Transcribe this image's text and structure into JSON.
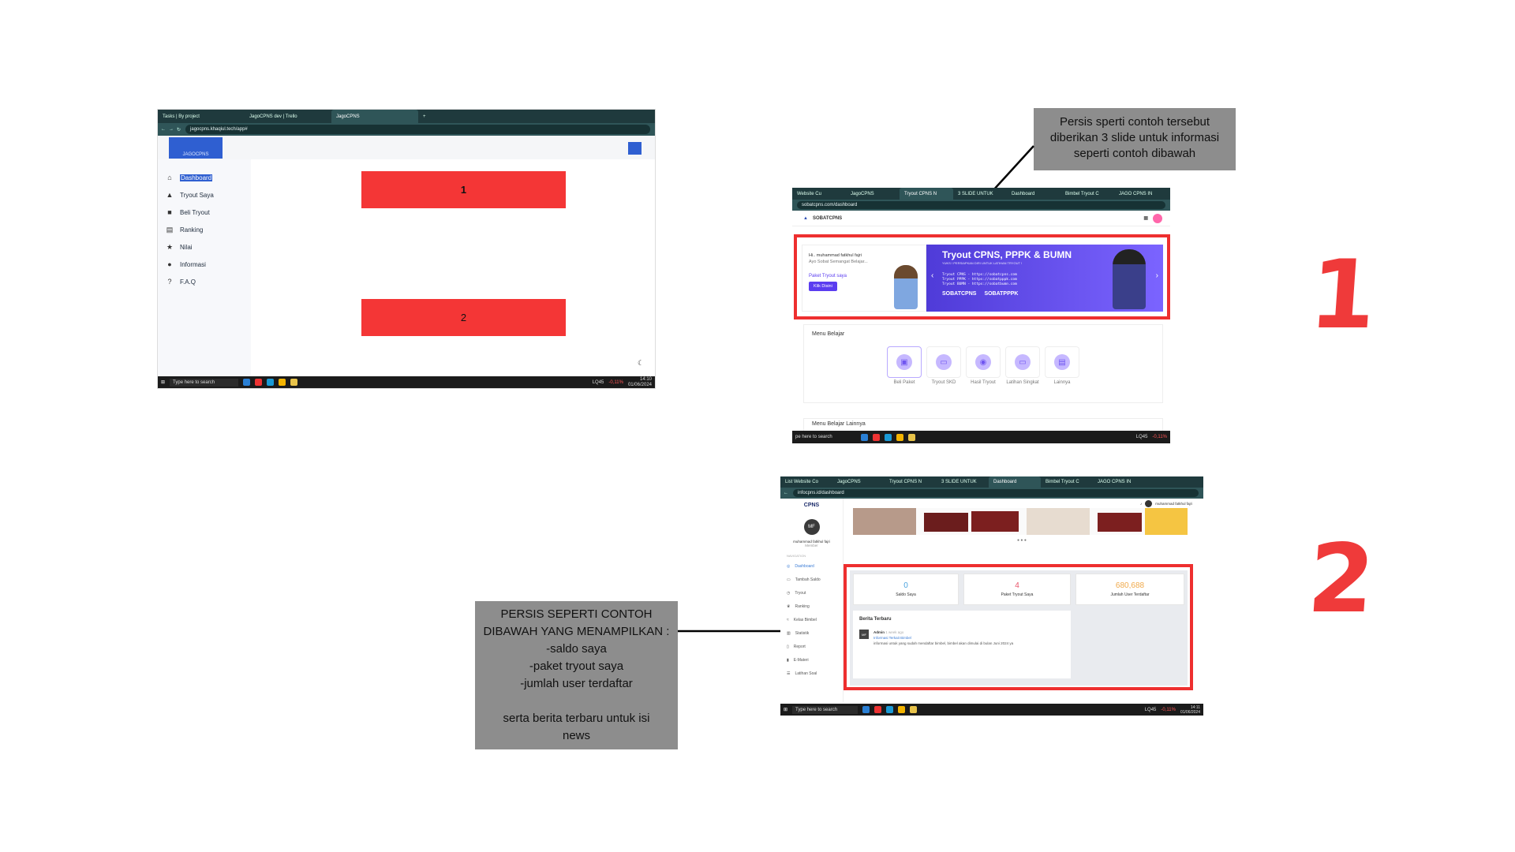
{
  "colors": {
    "annotation_gray": "#8d8d8d",
    "red": "#ef3a3a",
    "banner_purple": "#6f55f0",
    "chrome_teal": "#1f3a3d"
  },
  "left_shot": {
    "tabs": [
      "Tasks | By project",
      "JagoCPNS dev | Trello",
      "JagoCPNS"
    ],
    "url": "jagocpns.khaqiul.tech/app#",
    "logo_text": "JAGOCPNS",
    "sidebar": [
      "Dashboard",
      "Tryout Saya",
      "Beli Tryout",
      "Ranking",
      "Nilai",
      "Informasi",
      "F.A.Q"
    ],
    "placeholder_1": "1",
    "placeholder_2": "2",
    "taskbar": {
      "search": "Type here to search",
      "ticker": "LQ45",
      "change": "-0,11%",
      "time": "14:10",
      "date": "01/06/2024"
    }
  },
  "annotation_1": {
    "lines": [
      "Persis sperti contoh tersebut",
      "diberikan 3 slide untuk informasi",
      "seperti contoh dibawah"
    ]
  },
  "annotation_2": {
    "lines": [
      "PERSIS SEPERTI CONTOH",
      "DIBAWAH YANG MENAMPILKAN :",
      "-saldo saya",
      "-paket tryout saya",
      "-jumlah user terdaftar",
      "",
      "serta berita terbaru untuk isi",
      "news"
    ]
  },
  "label_1": "1",
  "label_2": "2",
  "sobat_shot": {
    "tabs": [
      "Website Cu",
      "JagoCPNS",
      "Tryout CPNS N",
      "3 SLIDE UNTUK",
      "Dashboard",
      "Bimbel Tryout C",
      "JAGO CPNS IN"
    ],
    "url": "sobatcpns.com/dashboard",
    "brand": "SOBATCPNS",
    "greeting": "Hi.. muhammad fatkhul fajri",
    "sub": "Ayo Sobat Semangat Belajar...",
    "paket": "Paket Tryout saya",
    "cta": "Klik Disini",
    "banner_title": "Tryout CPNS, PPPK & BUMN",
    "banner_sub": "YUKS ! PERSIAPKAN DIRI UNTUK LATIHAN TRYOUT !",
    "banner_links": [
      "Tryout CPNS  - https://sobatcpns.com",
      "Tryout PPPK  - https://sobatpppk.com",
      "Tryout BUMN  - https://sobatbumn.com"
    ],
    "banner_brands": [
      "SOBATCPNS",
      "SOBATPPPK"
    ],
    "menu_title": "Menu Belajar",
    "menu_items": [
      "Beli Paket",
      "Tryout SKD",
      "Hasil Tryout",
      "Latihan Singkat",
      "Lainnya"
    ],
    "menu_more": "Menu Belajar Lainnya",
    "taskbar": {
      "search": "pe here to search",
      "ticker": "LQ45",
      "change": "-0,11%"
    }
  },
  "infocpns_shot": {
    "tabs": [
      "List Website Co",
      "JagoCPNS",
      "Tryout CPNS N",
      "3 SLIDE UNTUK",
      "Dashboard",
      "Bimbel Tryout C",
      "JAGO CPNS IN"
    ],
    "url": "infocpns.id/dashboard",
    "logo": "CPNS",
    "user_initials": "MF",
    "user_name": "muhammad fatkhul fajri",
    "user_role": "Member",
    "nav_header": "NAVIGATION",
    "sidebar": [
      "Dashboard",
      "Tambah Saldo",
      "Tryout",
      "Ranking",
      "Kelas Bimbel",
      "Statistik",
      "Report",
      "E-Materi",
      "Latihan Soal"
    ],
    "top_user": "muhammad fatkhul fajri",
    "stats": [
      {
        "value": "0",
        "label": "Saldo Saya",
        "color": "#4aa3df"
      },
      {
        "value": "4",
        "label": "Paket Tryout Saya",
        "color": "#e9556b"
      },
      {
        "value": "680,688",
        "label": "Jumlah User Terdaftar",
        "color": "#f0a94a"
      }
    ],
    "news_title": "Berita Terbaru",
    "news_author": "Admin",
    "news_time": "1 week ago",
    "news_headline": "Informasi Terkait Bimbel",
    "news_body": "informasi untuk yang sudah mendaftar bimbel, bimbel akan dimulai di bulan Juni 2024 ya",
    "taskbar": {
      "search": "Type here to search",
      "ticker": "LQ45",
      "change": "-0,11%",
      "time": "14:11",
      "date": "01/06/2024"
    }
  }
}
